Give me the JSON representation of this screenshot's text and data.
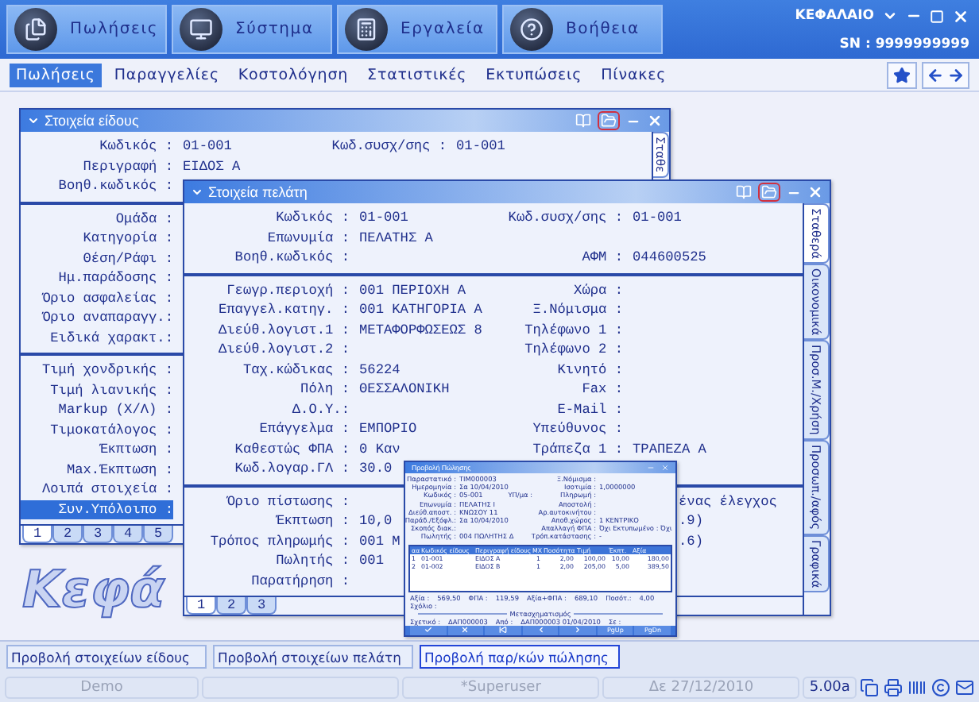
{
  "header": {
    "buttons": [
      {
        "label": "Πωλήσεις",
        "kind": "documents"
      },
      {
        "label": "Σύστημα",
        "kind": "monitor"
      },
      {
        "label": "Εργαλεία",
        "kind": "calculator"
      },
      {
        "label": "Βοήθεια",
        "kind": "help"
      }
    ],
    "company": "ΚΕΦΑΛΑΙΟ",
    "serial": "SN : 9999999999"
  },
  "menu": [
    {
      "label": "Πωλήσεις",
      "selected": true
    },
    {
      "label": "Παραγγελίες",
      "selected": false
    },
    {
      "label": "Κοστολόγηση",
      "selected": false
    },
    {
      "label": "Στατιστικές",
      "selected": false
    },
    {
      "label": "Εκτυπώσεις",
      "selected": false
    },
    {
      "label": "Πίνακες",
      "selected": false
    }
  ],
  "logo": "Κεφά",
  "item_window": {
    "title": "Στοιχεία είδους",
    "sections": [
      [
        {
          "label": "Κωδικός :",
          "value": "01-001",
          "right_label": "Κωδ.συσχ/σης :",
          "right_value": "01-001",
          "selected": false
        },
        {
          "label": "Περιγραφή :",
          "value": "ΕΙΔΟΣ Α",
          "selected": false
        },
        {
          "label": "Βοηθ.κωδικός :",
          "selected": false
        }
      ],
      [
        {
          "label": "Ομάδα :",
          "selected": false
        },
        {
          "label": "Κατηγορία :",
          "selected": false
        },
        {
          "label": "Θέση/Ράφι :",
          "selected": false
        },
        {
          "label": "Ημ.παράδοσης :",
          "selected": false
        },
        {
          "label": "Όριο ασφαλείας :",
          "selected": false
        },
        {
          "label": "Όριο αναπαραγγ.:",
          "selected": false
        },
        {
          "label": "Ειδικά χαρακτ.:",
          "selected": false
        }
      ],
      [
        {
          "label": "Τιμή χονδρικής :",
          "selected": false
        },
        {
          "label": "Τιμή λιανικής :",
          "selected": false
        },
        {
          "label": "Markup (Χ/Λ) :",
          "selected": false
        },
        {
          "label": "Τιμοκατάλογος :",
          "selected": false
        },
        {
          "label": "Έκπτωση :",
          "selected": false
        },
        {
          "label": "Max.Έκπτωση :",
          "selected": false
        },
        {
          "label": "Λοιπά στοιχεία :",
          "selected": false
        },
        {
          "label": "Συν.Υπόλοιπο :",
          "selected": true
        }
      ]
    ],
    "tabs": [
      {
        "label": "1",
        "selected": true
      },
      {
        "label": "2",
        "selected": false
      },
      {
        "label": "3",
        "selected": false
      },
      {
        "label": "4",
        "selected": false
      },
      {
        "label": "5",
        "selected": false
      }
    ],
    "side_tabs": [
      {
        "label": "Σταθε",
        "selected": true
      }
    ]
  },
  "customer_window": {
    "title": "Στοιχεία πελάτη",
    "sections": [
      [
        {
          "label": "Κωδικός :",
          "value": "01-001",
          "right_label": "Κωδ.συσχ/σης :",
          "right_value": "01-001"
        },
        {
          "label": "Επωνυμία :",
          "value": "ΠΕΛΑΤΗΣ Α"
        },
        {
          "label": "Βοηθ.κωδικός :",
          "right_label": "ΑΦΜ :",
          "right_value": "044600525"
        }
      ],
      [
        {
          "label": "Γεωγρ.περιοχή :",
          "value": "001 ΠΕΡΙΟΧΗ Α",
          "right_label": "Χώρα :"
        },
        {
          "label": "Επαγγελ.κατηγ. :",
          "value": "001 ΚΑΤΗΓΟΡΙΑ Α",
          "right_label": "Ξ.Νόμισμα :"
        },
        {
          "label": "Διεύθ.λογιστ.1 :",
          "value": "ΜΕΤΑΦΟΡΦΩΣΕΩΣ 8",
          "right_label": "Τηλέφωνο 1 :"
        },
        {
          "label": "Διεύθ.λογιστ.2 :",
          "right_label": "Τηλέφωνο 2 :"
        },
        {
          "label": "Ταχ.κώδικας :",
          "value": "56224",
          "right_label": "Κινητό :"
        },
        {
          "label": "Πόλη :",
          "value": "ΘΕΣΣΑΛΟΝΙΚΗ",
          "right_label": "Fax :"
        },
        {
          "label": "Δ.Ο.Υ.:",
          "right_label": "E-Mail :"
        },
        {
          "label": "Επάγγελμα :",
          "value": "ΕΜΠΟΡΙΟ",
          "right_label": "Υπεύθυνος :"
        },
        {
          "label": "Καθεστώς ΦΠΑ :",
          "value": "0 Καν",
          "right_label": "Τράπεζα 1 :",
          "right_value": "ΤΡΑΠΕΖΑ Α"
        },
        {
          "label": "Κωδ.λογαρ.ΓΛ :",
          "value": "30.0"
        }
      ],
      [
        {
          "label": "Όριο πίστωσης :",
          "note": "ένας έλεγχος"
        },
        {
          "label": "Έκπτωση :",
          "value": "10,0",
          "note": ".9)"
        },
        {
          "label": "Τρόπος πληρωμής :",
          "value": "001 Μ",
          "note": ".6)"
        },
        {
          "label": "Πωλητής :",
          "value": "001"
        },
        {
          "label": "Παρατήρηση :"
        }
      ]
    ],
    "tabs": [
      {
        "label": "1",
        "selected": true
      },
      {
        "label": "2",
        "selected": false
      },
      {
        "label": "3",
        "selected": false
      }
    ],
    "side_tabs": [
      {
        "label": "Σταθερά",
        "selected": true
      },
      {
        "label": "Οικονομικά",
        "selected": false
      },
      {
        "label": "Προσ.Μ./Χρήση",
        "selected": false
      },
      {
        "label": "Προσωπ./αφός",
        "selected": false
      },
      {
        "label": "Γραφικά",
        "selected": false
      }
    ]
  },
  "sale_window": {
    "title": "Προβολή Πώλησης",
    "fields": [
      {
        "label": "Παραστατικό :",
        "value": "ΤΙΜ000003",
        "right_label": "Ξ.Νόμισμα :"
      },
      {
        "label": "Ημερομηνία :",
        "value": "Σα 10/04/2010",
        "right_label": "Ισοτιμία :",
        "right_value": "1,0000000"
      },
      {
        "label": "Κωδικός :",
        "value": "05-001",
        "middle_label": "ΥΠ/μα :",
        "right_label": "Πληρωμή :"
      },
      {
        "label": "Επωνυμία :",
        "value": "ΠΕΛΑΤΗΣ Ι",
        "right_label": "Αποστολή :"
      },
      {
        "label": "Διεύθ.αποστ. :",
        "value": "ΚΝΩΣΟΥ 11",
        "right_label": "Αρ.αυτοκινήτου :"
      },
      {
        "label": "Παράδ./Εξόφλ.:",
        "value": "Σα 10/04/2010",
        "right_label": "Αποθ.χώρος :",
        "right_value": "1 ΚΕΝΤΡΙΚΟ"
      },
      {
        "label": "Σκοπός διακ.:",
        "right_label": "Απαλλαγή ΦΠΑ :",
        "right_value": "Όχι Εκτυπωμένο : Όχι"
      },
      {
        "label": "Πωλητής :",
        "value": "004 ΠΩΛΗΤΗΣ Δ",
        "right_label": "Τρόπ.κατάστασης :",
        "right_value": "-"
      }
    ],
    "table": {
      "columns": [
        "αα",
        "Κωδικός είδους",
        "Περιγραφή είδους",
        "ΜΧ",
        "Ποσότητα",
        "Τιμή",
        "Έκπτ.",
        "Αξία"
      ],
      "rows": [
        [
          "1",
          "01-001",
          "ΕΙΔΟΣ Α",
          "1",
          "2,00",
          "100,00",
          "10,00",
          "180,00"
        ],
        [
          "2",
          "01-002",
          "ΕΙΔΟΣ Β",
          "1",
          "2,00",
          "205,00",
          "5,00",
          "389,50"
        ]
      ]
    },
    "totals": [
      {
        "label": "Αξία :",
        "value": "569,50"
      },
      {
        "label": "ΦΠΑ :",
        "value": "119,59"
      },
      {
        "label": "Αξία+ΦΠΑ :",
        "value": "689,10"
      },
      {
        "label": "Ποσότ.:",
        "value": "4,00"
      }
    ],
    "comment_label": "Σχόλιο :",
    "transform_title": "Μετασχηματισμός",
    "related": [
      {
        "label": "Σχετικό :",
        "value": "ΔΑΠ000003"
      },
      {
        "label": "Από :",
        "value": "ΔΑΠ000003 01/04/2010"
      },
      {
        "label": "Σε :"
      }
    ],
    "buttons": [
      {
        "kind": "check"
      },
      {
        "kind": "close"
      },
      {
        "kind": "first"
      },
      {
        "kind": "prev"
      },
      {
        "kind": "next"
      },
      {
        "kind": "text",
        "label": "PgUp"
      },
      {
        "kind": "text",
        "label": "PgDn"
      }
    ]
  },
  "actions": [
    {
      "label": "Προβολή στοιχείων είδους",
      "selected": false
    },
    {
      "label": "Προβολή στοιχείων πελάτη",
      "selected": false
    },
    {
      "label": "Προβολή παρ/κών πώλησης",
      "selected": true
    }
  ],
  "status_bar": {
    "edition": "Demo",
    "user": "*Superuser",
    "date": "Δε 27/12/2010",
    "version": "5.00a"
  }
}
